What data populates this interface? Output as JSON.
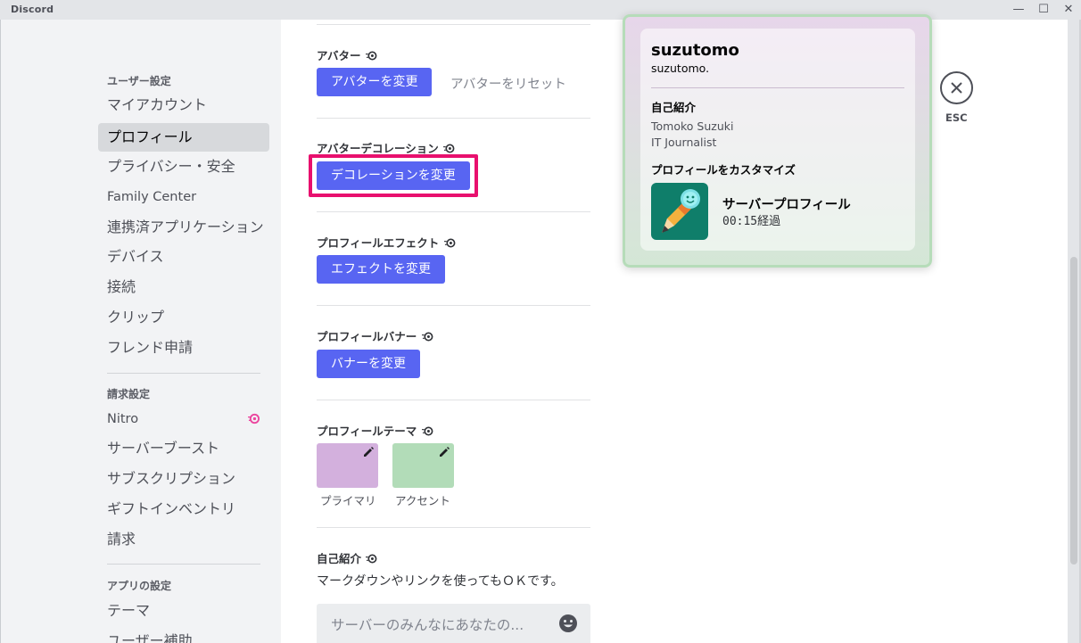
{
  "window": {
    "title": "Discord",
    "controls": {
      "minimize": "—",
      "maximize": "☐",
      "close": "✕"
    }
  },
  "sidebar": {
    "user_settings_header": "ユーザー設定",
    "user_items": [
      "マイアカウント",
      "プロフィール",
      "プライバシー・安全",
      "Family Center",
      "連携済アプリケーション",
      "デバイス",
      "接続",
      "クリップ",
      "フレンド申請"
    ],
    "active_item": "プロフィール",
    "billing_header": "請求設定",
    "billing_items": [
      "Nitro",
      "サーバーブースト",
      "サブスクリプション",
      "ギフトインベントリ",
      "請求"
    ],
    "app_header": "アプリの設定",
    "app_items": [
      "テーマ",
      "ユーザー補助"
    ]
  },
  "main": {
    "avatar": {
      "label": "アバター",
      "change": "アバターを変更",
      "reset": "アバターをリセット"
    },
    "decoration": {
      "label": "アバターデコレーション",
      "change": "デコレーションを変更"
    },
    "effect": {
      "label": "プロフィールエフェクト",
      "change": "エフェクトを変更"
    },
    "banner": {
      "label": "プロフィールバナー",
      "change": "バナーを変更"
    },
    "theme": {
      "label": "プロフィールテーマ",
      "primary": "プライマリ",
      "accent": "アクセント"
    },
    "bio": {
      "label": "自己紹介",
      "help": "マークダウンやリンクを使ってもＯＫです。",
      "placeholder": "サーバーのみんなにあなたの..."
    }
  },
  "preview": {
    "display_name": "suzutomo",
    "username": "suzutomo.",
    "about_header": "自己紹介",
    "about_lines": [
      "Tomoko Suzuki",
      "IT Journalist"
    ],
    "customize_header": "プロフィールをカスタマイズ",
    "activity_title": "サーバープロフィール",
    "activity_elapsed": "00:15経過"
  },
  "close_label": "ESC",
  "colors": {
    "brand": "#5865f2",
    "highlight": "#e8106e",
    "nitro": "#eb459e",
    "theme_primary": "#d3b0dd",
    "theme_accent": "#b2dcb8"
  },
  "icons": [
    "nitro-icon",
    "pencil-icon",
    "emoji-icon",
    "close-icon",
    "pencil-activity-icon"
  ]
}
